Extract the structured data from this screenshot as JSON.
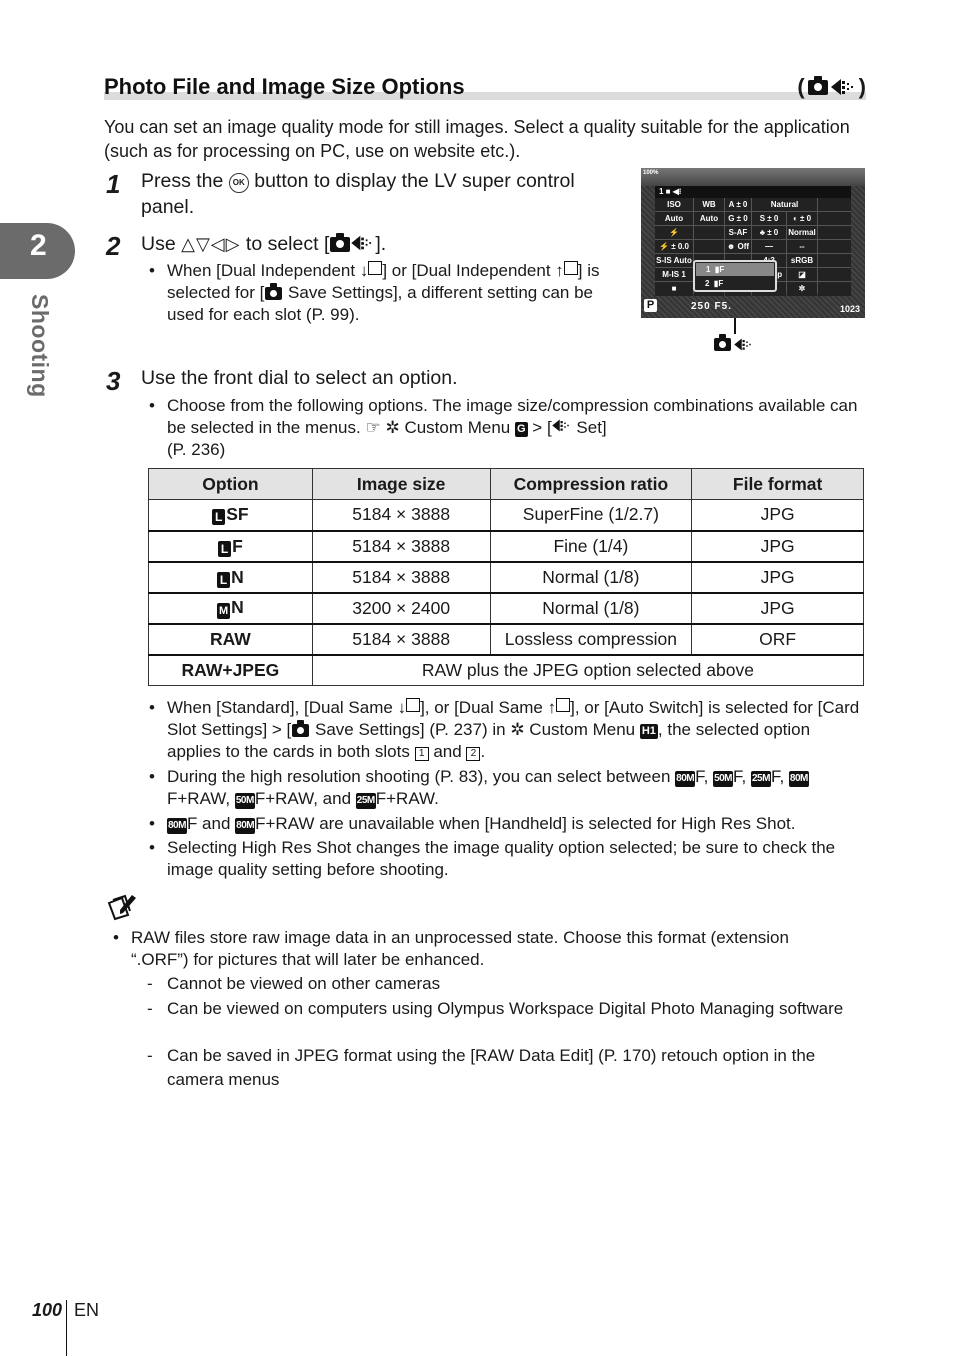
{
  "chapter": {
    "number": "2",
    "label": "Shooting"
  },
  "title": {
    "text": "Photo File and Image Size Options",
    "icon_open": "(",
    "icon_close": ")"
  },
  "intro": "You can set an image quality mode for still images. Select a quality suitable for the application (such as for processing on PC, use on website etc.).",
  "steps": [
    {
      "num": "1",
      "text_before": "Press the",
      "icon": "OK",
      "text_after": "button to display the LV super control panel."
    },
    {
      "num": "2",
      "text_before": "Use",
      "arrows": "△▽◁▷",
      "text_after": "to select [",
      "text_end": "].",
      "bullet": {
        "p1": "When [Dual Independent ",
        "p2": "] or [Dual Independent ",
        "p3": "] is selected for [",
        "p4": " Save Settings], a different setting can be used for each slot (P. 99).",
        "down_glyph": "↓",
        "up_glyph": "↑"
      }
    },
    {
      "num": "3",
      "text": "Use the front dial to select an option.",
      "bullet": {
        "p1": "Choose from the following options. The image size/compression combinations available can be selected in the menus.",
        "ref_icon": "☞",
        "gear_glyph": "✲",
        "p2": "Custom Menu",
        "menu_badge": "G",
        "p3": "> [",
        "p4": "Set]",
        "p5": "(P. 236)"
      }
    }
  ],
  "lcd": {
    "battery": "100%",
    "header": "1",
    "cells": [
      "ISO",
      "WB",
      "A ± 0",
      "",
      "Natural",
      "",
      "Auto",
      "Auto",
      "G ± 0",
      "S ± 0",
      "◐ ± 0",
      "",
      "⚡",
      "",
      "S-AF",
      "♣ ± 0",
      "Normal",
      "",
      "⚡ ± 0.0",
      "",
      "☻ Off",
      "—",
      "--",
      "",
      "S-IS Auto",
      "",
      "",
      "4:3",
      "sRGB",
      "",
      "M-IS 1",
      "",
      "",
      "4K 30p",
      "◪",
      "",
      "",
      "",
      "",
      "",
      "✲",
      ""
    ],
    "popup": [
      {
        "slot": "1",
        "value": "F"
      },
      {
        "slot": "2",
        "value": "F"
      }
    ],
    "mode": "P",
    "exposure": "250  F5.",
    "remaining": "1023"
  },
  "table": {
    "headers": [
      "Option",
      "Image size",
      "Compression ratio",
      "File format"
    ],
    "rows": [
      {
        "size_badge": "L",
        "option": "SF",
        "image_size": "5184 × 3888",
        "compression": "SuperFine (1/2.7)",
        "format": "JPG"
      },
      {
        "size_badge": "L",
        "option": "F",
        "image_size": "5184 × 3888",
        "compression": "Fine (1/4)",
        "format": "JPG"
      },
      {
        "size_badge": "L",
        "option": "N",
        "image_size": "5184 × 3888",
        "compression": "Normal (1/8)",
        "format": "JPG"
      },
      {
        "size_badge": "M",
        "option": "N",
        "image_size": "3200 × 2400",
        "compression": "Normal (1/8)",
        "format": "JPG"
      },
      {
        "size_badge": "",
        "option": "RAW",
        "image_size": "5184 × 3888",
        "compression": "Lossless compression",
        "format": "ORF"
      }
    ],
    "last_row": {
      "option": "RAW+JPEG",
      "description": "RAW plus the JPEG option selected above"
    }
  },
  "after_bullets": {
    "b1": {
      "p1": "When [Standard], [Dual Same ",
      "p2": "], or [Dual Same ",
      "p3": "], or [Auto Switch] is selected for [Card Slot Settings] > [",
      "p4": " Save Settings] (P. 237) in",
      "p5": "Custom Menu",
      "badge": "H1",
      "p6": ", the selected option applies to the cards in both slots",
      "slot1": "1",
      "and": "and",
      "slot2": "2",
      "end": "."
    },
    "b2": {
      "p1": "During the high resolution shooting (P. 83), you can select between",
      "items": [
        "80M",
        "50M",
        "25M",
        "80M",
        "50M",
        "25M"
      ],
      "suffixes": [
        "F,",
        "F,",
        "F,",
        "F+RAW,",
        "F+RAW, and",
        "F+RAW."
      ]
    },
    "b3": {
      "badge": "80M",
      "p1": "F and",
      "p2": "F+RAW are unavailable when [Handheld] is selected for High Res Shot."
    },
    "b4": "Selecting High Res Shot changes the image quality option selected; be sure to check the image quality setting before shooting."
  },
  "notes": {
    "main": "RAW files store raw image data in an unprocessed state. Choose this format (extension “.ORF”) for pictures that will later be enhanced.",
    "subs": [
      "Cannot be viewed on other cameras",
      "Can be viewed on computers using Olympus Workspace Digital Photo Managing software",
      "Can be saved in JPEG format using the [RAW Data Edit] (P. 170) retouch option in the camera menus"
    ]
  },
  "footer": {
    "page": "100",
    "lang": "EN"
  }
}
